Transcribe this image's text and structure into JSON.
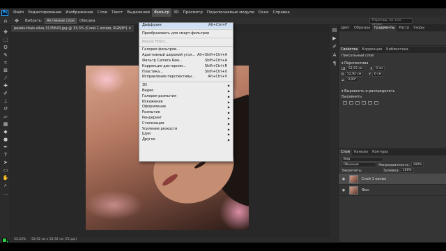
{
  "app": {
    "logo": "Ps"
  },
  "menubar": {
    "items": [
      "Файл",
      "Редактирование",
      "Изображение",
      "Слои",
      "Текст",
      "Выделение",
      "Фильтр",
      "3D",
      "Просмотр",
      "Подключаемые модули",
      "Окно",
      "Справка"
    ],
    "active_index": 6
  },
  "optbar": {
    "home_icon": "home-icon",
    "select_label": "Выбрать:",
    "select_value": "Активные слои",
    "options_label": "Обводка",
    "search_placeholder": "Перетащ. по. кнп. огран."
  },
  "document": {
    "tab_label": "pexels-thais-silva-3135643.jpg @ 33,3% (Слой 1 копия, RGB/8*) ×"
  },
  "filter_menu": {
    "items": [
      {
        "label": "Диффузия",
        "shortcut": "Alt+Ctrl+F",
        "highlight": true
      },
      {
        "sep": true
      },
      {
        "label": "Преобразовать для смарт-фильтров"
      },
      {
        "sep": true
      },
      {
        "label": "Neural Filters...",
        "disabled": true
      },
      {
        "sep": true
      },
      {
        "label": "Галерея фильтров..."
      },
      {
        "label": "Адаптивный широкий угол...",
        "shortcut": "Alt+Shift+Ctrl+A"
      },
      {
        "label": "Фильтр Camera Raw...",
        "shortcut": "Shift+Ctrl+A"
      },
      {
        "label": "Коррекция дисторсии...",
        "shortcut": "Shift+Ctrl+R"
      },
      {
        "label": "Пластика...",
        "shortcut": "Shift+Ctrl+X"
      },
      {
        "label": "Исправление перспективы...",
        "shortcut": "Alt+Ctrl+V"
      },
      {
        "sep": true
      },
      {
        "label": "3D",
        "submenu": true
      },
      {
        "label": "Видео",
        "submenu": true
      },
      {
        "label": "Галерея размытия",
        "submenu": true
      },
      {
        "label": "Искажение",
        "submenu": true
      },
      {
        "label": "Оформление",
        "submenu": true
      },
      {
        "label": "Размытие",
        "submenu": true
      },
      {
        "label": "Рендеринг",
        "submenu": true
      },
      {
        "label": "Стилизация",
        "submenu": true
      },
      {
        "label": "Усиление резкости",
        "submenu": true
      },
      {
        "label": "Шум",
        "submenu": true
      },
      {
        "label": "Другое",
        "submenu": true
      }
    ]
  },
  "right_panel": {
    "top_tabs": [
      "Цвет",
      "Образцы",
      "Градиенты",
      "Растр",
      "Узоры"
    ],
    "props_tabs": [
      "Свойства",
      "Коррекция",
      "Библиотеки"
    ],
    "pixel_layer": "Пиксельный слой",
    "transform_title": "Перспектива",
    "w": "52,92 см",
    "h": "52,92 см",
    "x": "0 см",
    "y": "0 см",
    "angle": "0,00°",
    "align_title": "Выровнять и распределить",
    "align_sub": "Выравнить:",
    "layers_tabs": [
      "Слои",
      "Каналы",
      "Контуры"
    ],
    "kind": "Вид",
    "blend": "Обычные",
    "opacity_label": "Непрозрачность:",
    "opacity": "100%",
    "lock_label": "Закрепить:",
    "fill_label": "Заливка:",
    "fill": "100%",
    "layers": [
      {
        "name": "Слой 1 копия",
        "selected": true
      },
      {
        "name": "Фон",
        "selected": false
      }
    ]
  },
  "status": {
    "zoom": "33,33%",
    "doc_size": "52,92 см x 52,92 см (72 ppi)"
  }
}
